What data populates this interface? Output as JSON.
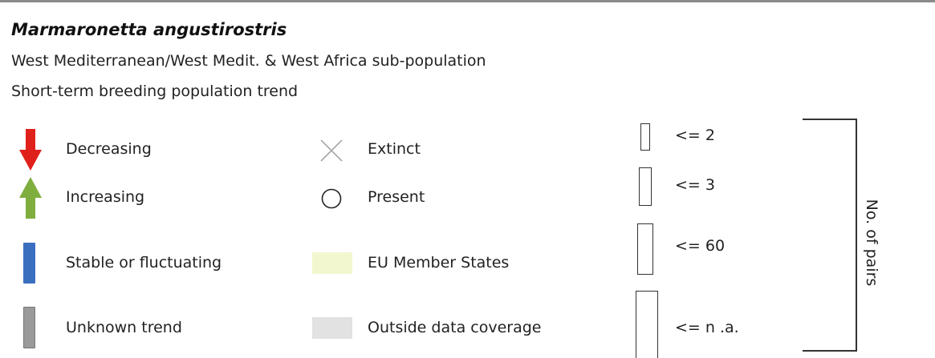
{
  "header": {
    "species": "Marmaronetta angustirostris",
    "subpopulation": "West Mediterranean/West Medit. & West Africa sub-population",
    "trend_title": "Short-term breeding population trend"
  },
  "trend_legend": [
    {
      "icon": "red-down-arrow-icon",
      "label": "Decreasing",
      "color": "#e0201b"
    },
    {
      "icon": "green-up-arrow-icon",
      "label": "Increasing",
      "color": "#7fae3f"
    },
    {
      "icon": "blue-bar-icon",
      "label": "Stable or fluctuating",
      "color": "#3a6fc0"
    },
    {
      "icon": "grey-bar-icon",
      "label": "Unknown trend",
      "color": "#9a9a9a"
    }
  ],
  "status_legend": [
    {
      "icon": "cross-icon",
      "label": "Extinct"
    },
    {
      "icon": "circle-icon",
      "label": "Present"
    },
    {
      "icon": "eu-swatch",
      "label": "EU Member States",
      "color": "#f3f7cf"
    },
    {
      "icon": "outside-swatch",
      "label": "Outside data coverage",
      "color": "#e2e2e2"
    }
  ],
  "size_legend": {
    "title": "No. of pairs",
    "items": [
      {
        "label": "<= 2"
      },
      {
        "label": "<= 3"
      },
      {
        "label": "<= 60"
      },
      {
        "label": "<= n .a."
      }
    ]
  }
}
